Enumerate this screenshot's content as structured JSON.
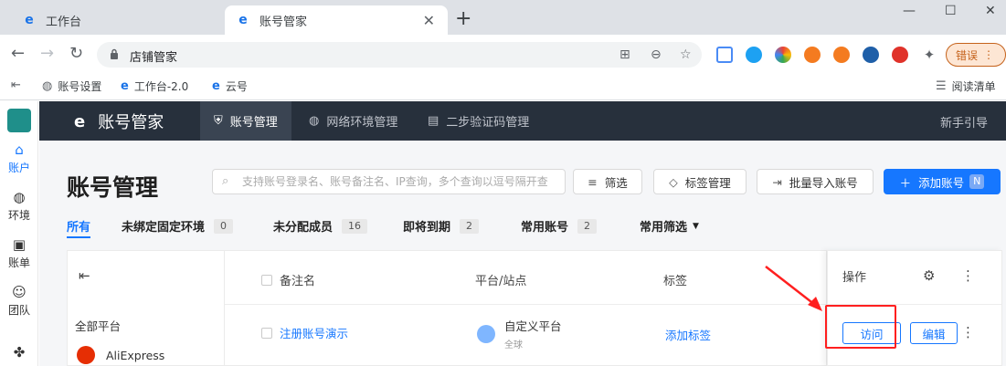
{
  "browser": {
    "tabs": [
      {
        "label": "工作台"
      },
      {
        "label": "账号管家"
      }
    ],
    "address": "店铺管家",
    "error_label": "错误",
    "bookmarks": [
      "账号设置",
      "工作台-2.0",
      "云号"
    ],
    "reading_list": "阅读清单"
  },
  "rail": {
    "items": [
      "账户",
      "环境",
      "账单",
      "团队"
    ]
  },
  "header": {
    "app_title": "账号管家",
    "nav": [
      "账号管理",
      "网络环境管理",
      "二步验证码管理"
    ],
    "guide": "新手引导"
  },
  "page": {
    "title": "账号管理",
    "search_placeholder": "支持账号登录名、账号备注名、IP查询，多个查询以逗号隔开查",
    "buttons": {
      "filter": "筛选",
      "tag_manage": "标签管理",
      "bulk_import": "批量导入账号",
      "add_account": "添加账号",
      "add_account_key": "N"
    },
    "filters": [
      {
        "label": "所有",
        "count": null
      },
      {
        "label": "未绑定固定环境",
        "count": "0"
      },
      {
        "label": "未分配成员",
        "count": "16"
      },
      {
        "label": "即将到期",
        "count": "2"
      },
      {
        "label": "常用账号",
        "count": "2"
      },
      {
        "label": "常用筛选",
        "count": null
      }
    ]
  },
  "platforms": {
    "all": "全部平台",
    "items": [
      "AliExpress"
    ]
  },
  "table": {
    "columns": [
      "备注名",
      "平台/站点",
      "标签"
    ],
    "op_header": "操作",
    "rows": [
      {
        "name": "注册账号演示",
        "platform": "自定义平台",
        "site": "全球",
        "tag": "添加标签",
        "visit": "访问",
        "edit": "编辑"
      }
    ]
  },
  "colors": {
    "primary": "#1677ff",
    "header_bg": "#27303c",
    "highlight": "#ff1f1f"
  }
}
